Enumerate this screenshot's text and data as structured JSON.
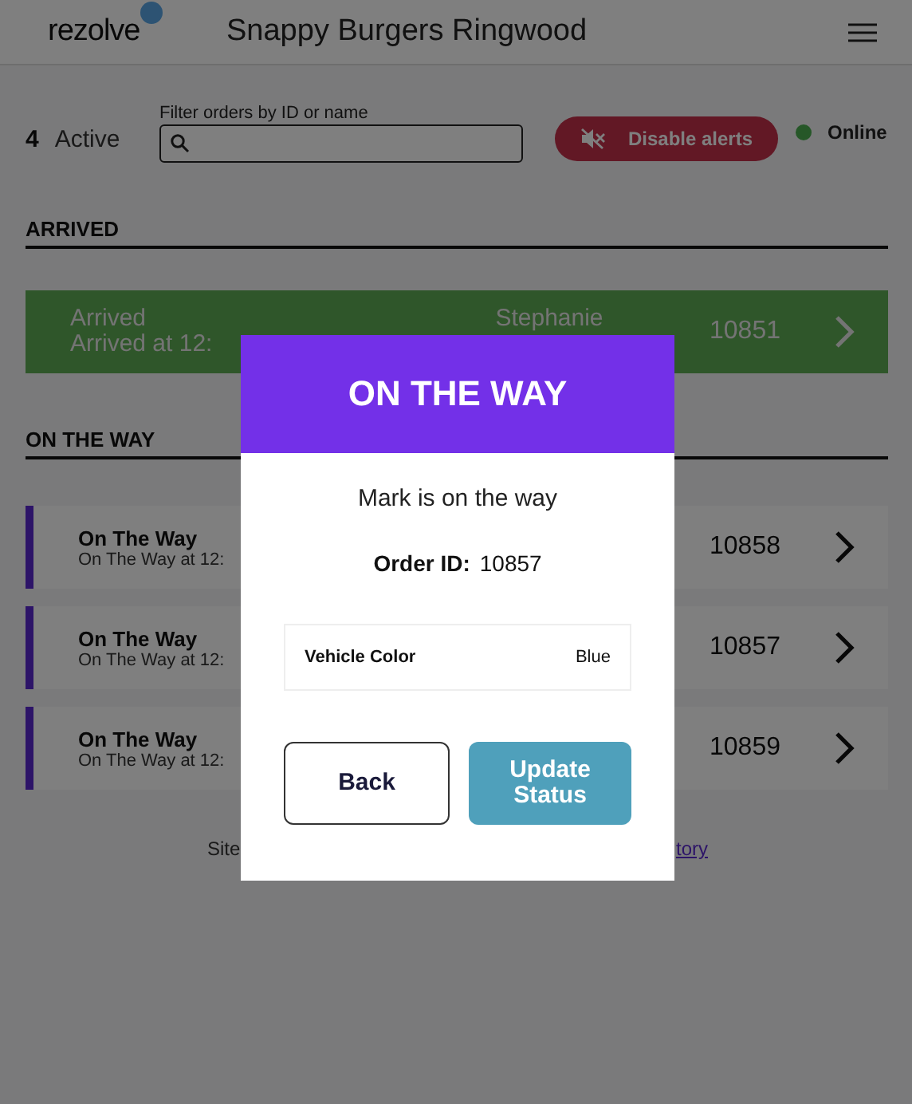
{
  "header": {
    "logo": "rezolve",
    "title": "Snappy Burgers Ringwood"
  },
  "toolbar": {
    "active_count": "4",
    "active_label": "Active",
    "filter_label": "Filter orders by ID or name",
    "alerts_button": "Disable alerts",
    "status": {
      "label": "Online"
    }
  },
  "sections": [
    {
      "title": "ARRIVED",
      "orders": [
        {
          "kind": "arrived",
          "status": "Arrived",
          "time": "Arrived at 12:",
          "name": "Stephanie",
          "id": "10851"
        }
      ]
    },
    {
      "title": "ON THE WAY",
      "orders": [
        {
          "kind": "on_the_way",
          "status": "On The Way",
          "time": "On The Way at 12:",
          "id": "10858"
        },
        {
          "kind": "on_the_way",
          "status": "On The Way",
          "time": "On The Way at 12:",
          "id": "10857"
        },
        {
          "kind": "on_the_way",
          "status": "On The Way",
          "time": "On The Way at 12:",
          "id": "10859"
        }
      ]
    }
  ],
  "footer": {
    "text": "Site",
    "link": "tory"
  },
  "modal": {
    "title": "ON THE WAY",
    "message": "Mark is on the way",
    "order_id_label": "Order ID:",
    "order_id": "10857",
    "details": [
      {
        "label": "Vehicle Color",
        "value": "Blue"
      }
    ],
    "buttons": [
      {
        "label": "Back",
        "kind": "secondary"
      },
      {
        "label": "Update Status",
        "kind": "primary"
      }
    ]
  }
}
